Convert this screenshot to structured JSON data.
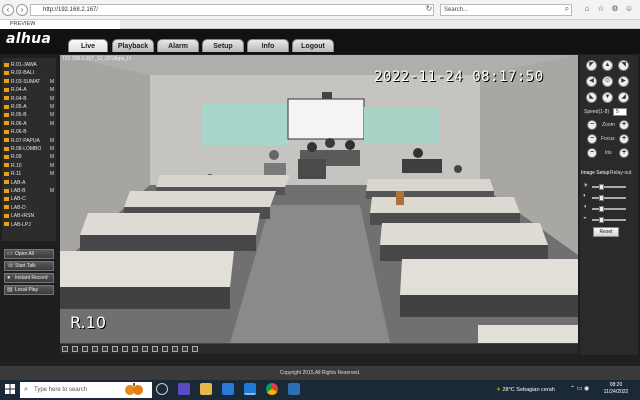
{
  "browser": {
    "url": "http://192.168.2.167/",
    "search_placeholder": "Search...",
    "tab_title": "PREVIEW"
  },
  "app": {
    "logo": "alhua",
    "nav_tabs": [
      "Live",
      "Playback",
      "Alarm",
      "Setup",
      "Info",
      "Logout"
    ],
    "active_tab": "Live",
    "copyright": "Copyright 2015,All Rights Reserved."
  },
  "channels": [
    {
      "label": "R.01-JAWA",
      "flag": ""
    },
    {
      "label": "R.02-BALI",
      "flag": ""
    },
    {
      "label": "R.03-SUMAT",
      "flag": "M"
    },
    {
      "label": "R.04-A",
      "flag": "M"
    },
    {
      "label": "R.04-B",
      "flag": "M"
    },
    {
      "label": "R.05-A",
      "flag": "M"
    },
    {
      "label": "R.05-B",
      "flag": "M"
    },
    {
      "label": "R.06-A",
      "flag": "M"
    },
    {
      "label": "R.06-B",
      "flag": ""
    },
    {
      "label": "R.07-PAPUA",
      "flag": "M"
    },
    {
      "label": "R.08-LOMBO",
      "flag": "M"
    },
    {
      "label": "R.09",
      "flag": "M"
    },
    {
      "label": "R.10",
      "flag": "M"
    },
    {
      "label": "R.11",
      "flag": "M"
    },
    {
      "label": "LAB-A",
      "flag": ""
    },
    {
      "label": "LAB-B",
      "flag": "M"
    },
    {
      "label": "LAB-C",
      "flag": ""
    },
    {
      "label": "LAB-D",
      "flag": ""
    },
    {
      "label": "LAB-IRSN",
      "flag": ""
    },
    {
      "label": "LAB-LPJ",
      "flag": ""
    }
  ],
  "side_buttons": {
    "open_all": "Open All",
    "start_talk": "Start Talk",
    "instant_record": "Instant Record",
    "local_play": "Local Play"
  },
  "video": {
    "info": "192.168.2.167_12_0218bps_H",
    "timestamp": "2022-11-24 08:17:50",
    "channel_label": "R.10"
  },
  "ptz": {
    "speed_label": "Speed(1-8)",
    "speed_value": "5",
    "zoom": "Zoom",
    "focus": "Focus",
    "iris": "Iris",
    "image_setup": "Image Setup",
    "relay_out": "Relay-out",
    "reset": "Reset"
  },
  "taskbar": {
    "search_placeholder": "Type here to search",
    "weather": "28°C  Sebagian cerah",
    "time": "08:20",
    "date": "11/24/2022"
  }
}
